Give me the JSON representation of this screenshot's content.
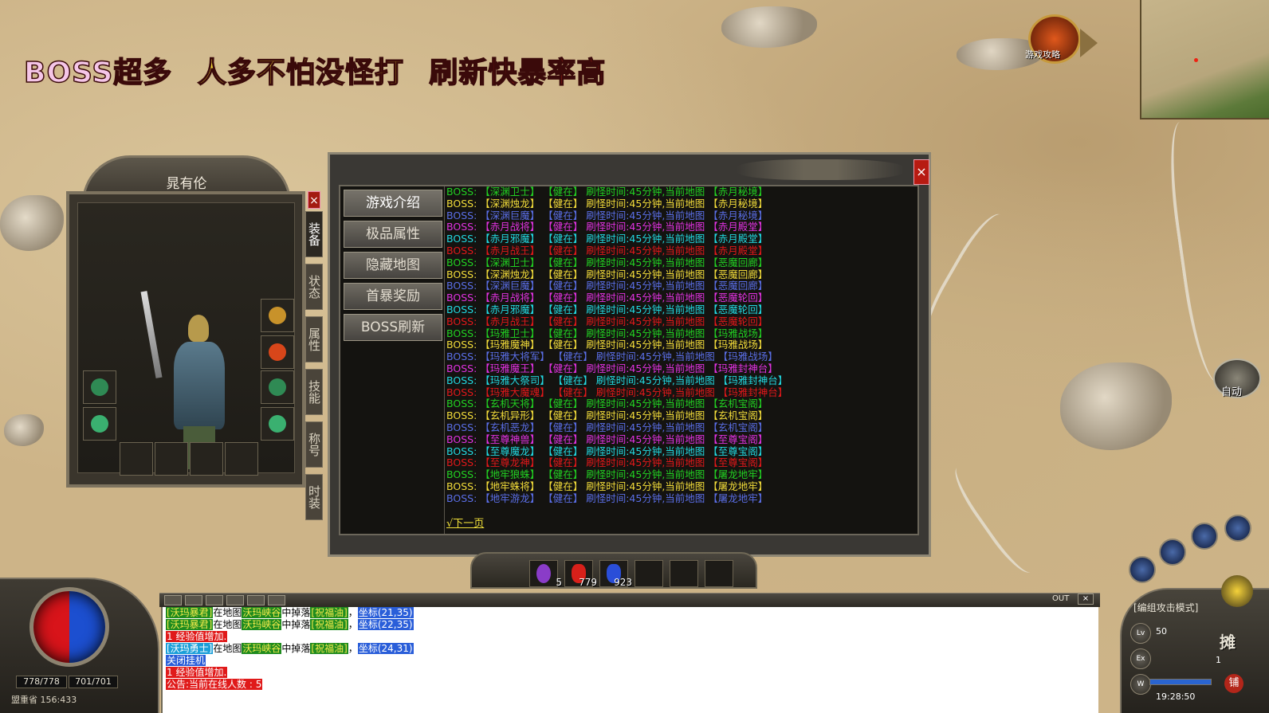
{
  "banner": {
    "part1": "BOSS超多",
    "part2": "人多不怕没怪打",
    "part3": "刷新快暴率高"
  },
  "guide": {
    "label": "游戏攻略"
  },
  "character": {
    "name": "晁有伦",
    "close": "×",
    "tabs": [
      "装备",
      "状态",
      "属性",
      "技能",
      "称号",
      "时装"
    ]
  },
  "popup": {
    "close": "×",
    "menu": [
      "游戏介绍",
      "极品属性",
      "隐藏地图",
      "首暴奖励",
      "BOSS刷新"
    ],
    "next_page": "√下一页",
    "boss_rows": [
      {
        "text": "BOSS: 【深渊卫士】 【健在】 刷怪时间:45分钟,当前地图 【赤月秘境】",
        "color": "#22d022"
      },
      {
        "text": "BOSS: 【深渊烛龙】 【健在】 刷怪时间:45分钟,当前地图 【赤月秘境】",
        "color": "#f2dc3a"
      },
      {
        "text": "BOSS: 【深渊巨魔】 【健在】 刷怪时间:45分钟,当前地图 【赤月秘境】",
        "color": "#5a6ee6"
      },
      {
        "text": "BOSS: 【赤月战将】 【健在】 刷怪时间:45分钟,当前地图 【赤月殿堂】",
        "color": "#e032e0"
      },
      {
        "text": "BOSS: 【赤月邪魔】 【健在】 刷怪时间:45分钟,当前地图 【赤月殿堂】",
        "color": "#22d8e0"
      },
      {
        "text": "BOSS: 【赤月战王】 【健在】 刷怪时间:45分钟,当前地图 【赤月殿堂】",
        "color": "#e2181a"
      },
      {
        "text": "BOSS: 【深渊卫士】 【健在】 刷怪时间:45分钟,当前地图 【恶魔回廊】",
        "color": "#22d022"
      },
      {
        "text": "BOSS: 【深渊烛龙】 【健在】 刷怪时间:45分钟,当前地图 【恶魔回廊】",
        "color": "#f2dc3a"
      },
      {
        "text": "BOSS: 【深渊巨魔】 【健在】 刷怪时间:45分钟,当前地图 【恶魔回廊】",
        "color": "#5a6ee6"
      },
      {
        "text": "BOSS: 【赤月战将】 【健在】 刷怪时间:45分钟,当前地图 【恶魔轮回】",
        "color": "#e032e0"
      },
      {
        "text": "BOSS: 【赤月邪魔】 【健在】 刷怪时间:45分钟,当前地图 【恶魔轮回】",
        "color": "#22d8e0"
      },
      {
        "text": "BOSS: 【赤月战王】 【健在】 刷怪时间:45分钟,当前地图 【恶魔轮回】",
        "color": "#e2181a"
      },
      {
        "text": "BOSS: 【玛雅卫士】 【健在】 刷怪时间:45分钟,当前地图 【玛雅战场】",
        "color": "#22d022"
      },
      {
        "text": "BOSS: 【玛雅魔神】 【健在】 刷怪时间:45分钟,当前地图 【玛雅战场】",
        "color": "#f2dc3a"
      },
      {
        "text": "BOSS: 【玛雅大将军】 【健在】 刷怪时间:45分钟,当前地图 【玛雅战场】",
        "color": "#5a6ee6"
      },
      {
        "text": "BOSS: 【玛雅魔王】 【健在】 刷怪时间:45分钟,当前地图 【玛雅封神台】",
        "color": "#e032e0"
      },
      {
        "text": "BOSS: 【玛雅大祭司】 【健在】 刷怪时间:45分钟,当前地图 【玛雅封神台】",
        "color": "#22d8e0"
      },
      {
        "text": "BOSS: 【玛雅大魔魂】 【健在】 刷怪时间:45分钟,当前地图 【玛雅封神台】",
        "color": "#e2181a"
      },
      {
        "text": "BOSS: 【玄机天将】 【健在】 刷怪时间:45分钟,当前地图 【玄机宝阁】",
        "color": "#22d022"
      },
      {
        "text": "BOSS: 【玄机异形】 【健在】 刷怪时间:45分钟,当前地图 【玄机宝阁】",
        "color": "#f2dc3a"
      },
      {
        "text": "BOSS: 【玄机恶龙】 【健在】 刷怪时间:45分钟,当前地图 【玄机宝阁】",
        "color": "#5a6ee6"
      },
      {
        "text": "BOSS: 【至尊神兽】 【健在】 刷怪时间:45分钟,当前地图 【至尊宝阁】",
        "color": "#e032e0"
      },
      {
        "text": "BOSS: 【至尊魔龙】 【健在】 刷怪时间:45分钟,当前地图 【至尊宝阁】",
        "color": "#22d8e0"
      },
      {
        "text": "BOSS: 【至尊龙神】 【健在】 刷怪时间:45分钟,当前地图 【至尊宝阁】",
        "color": "#e2181a"
      },
      {
        "text": "BOSS: 【地牢狼蛛】 【健在】 刷怪时间:45分钟,当前地图 【屠龙地牢】",
        "color": "#22d022"
      },
      {
        "text": "BOSS: 【地牢蛛将】 【健在】 刷怪时间:45分钟,当前地图 【屠龙地牢】",
        "color": "#f2dc3a"
      },
      {
        "text": "BOSS: 【地牢游龙】 【健在】 刷怪时间:45分钟,当前地图 【屠龙地牢】",
        "color": "#5a6ee6"
      }
    ]
  },
  "belt": {
    "slot1_count": "5",
    "slot2_count": "779",
    "slot3_count": "923"
  },
  "status": {
    "hp": "778/778",
    "mp": "701/701",
    "location": "盟重省 156:433"
  },
  "chat": {
    "out_label": "OUT",
    "close": "×",
    "lines": [
      {
        "parts": [
          {
            "t": "[沃玛暴君]",
            "c": "t-green"
          },
          {
            "t": "在地图",
            "c": ""
          },
          {
            "t": "沃玛峡谷",
            "c": "t-green"
          },
          {
            "t": "中掉落",
            "c": ""
          },
          {
            "t": "[祝福油]",
            "c": "t-green"
          },
          {
            "t": "，",
            "c": ""
          },
          {
            "t": "坐标(21,35)",
            "c": "t-blue"
          }
        ]
      },
      {
        "parts": [
          {
            "t": "[沃玛暴君]",
            "c": "t-green"
          },
          {
            "t": "在地图",
            "c": ""
          },
          {
            "t": "沃玛峡谷",
            "c": "t-green"
          },
          {
            "t": "中掉落",
            "c": ""
          },
          {
            "t": "[祝福油]",
            "c": "t-green"
          },
          {
            "t": "，",
            "c": ""
          },
          {
            "t": "坐标(22,35)",
            "c": "t-blue"
          }
        ]
      },
      {
        "parts": [
          {
            "t": "1 经验值增加.",
            "c": "t-red"
          }
        ]
      },
      {
        "parts": [
          {
            "t": "[沃玛勇士]",
            "c": "t-cyan"
          },
          {
            "t": "在地图",
            "c": ""
          },
          {
            "t": "沃玛峡谷",
            "c": "t-green"
          },
          {
            "t": "中掉落",
            "c": ""
          },
          {
            "t": "[祝福油]",
            "c": "t-green"
          },
          {
            "t": "，",
            "c": ""
          },
          {
            "t": "坐标(24,31)",
            "c": "t-blue"
          }
        ]
      },
      {
        "parts": [
          {
            "t": "关闭挂机",
            "c": "t-blue"
          }
        ]
      },
      {
        "parts": [
          {
            "t": "1 经验值增加.",
            "c": "t-red"
          }
        ]
      },
      {
        "parts": [
          {
            "t": "公告:当前在线人数 : 5",
            "c": "t-red"
          }
        ]
      }
    ]
  },
  "right_panel": {
    "mode": "[编组攻击模式]",
    "level": "50",
    "count": "1",
    "time": "19:28:50",
    "stall": "摊",
    "shop": "铺",
    "auto": "自动"
  }
}
